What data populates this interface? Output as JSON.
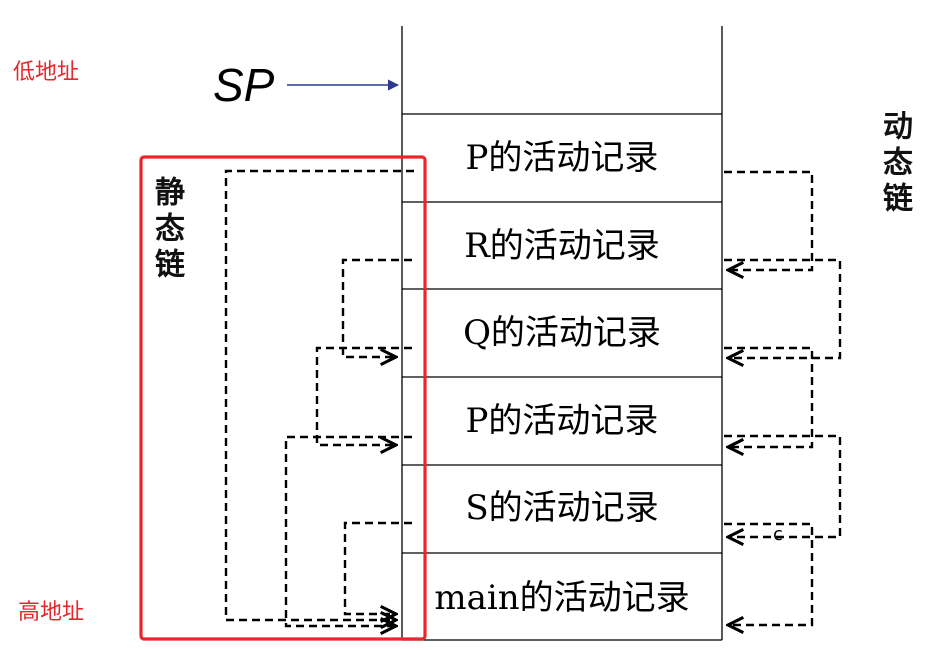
{
  "labels": {
    "low_address": "低地址",
    "high_address": "高地址",
    "sp": "SP",
    "static_chain": "静态链",
    "dynamic_chain": "动态链",
    "stray_mark": "c"
  },
  "frames": [
    {
      "label": ""
    },
    {
      "label": "P的活动记录"
    },
    {
      "label": "R的活动记录"
    },
    {
      "label": "Q的活动记录"
    },
    {
      "label": "P的活动记录"
    },
    {
      "label": "S的活动记录"
    },
    {
      "label": "main的活动记录"
    }
  ],
  "colors": {
    "highlight_box": "#e8262b",
    "address_text": "#e8262b",
    "sp_arrow": "#2b3a8c",
    "line": "#000000"
  }
}
